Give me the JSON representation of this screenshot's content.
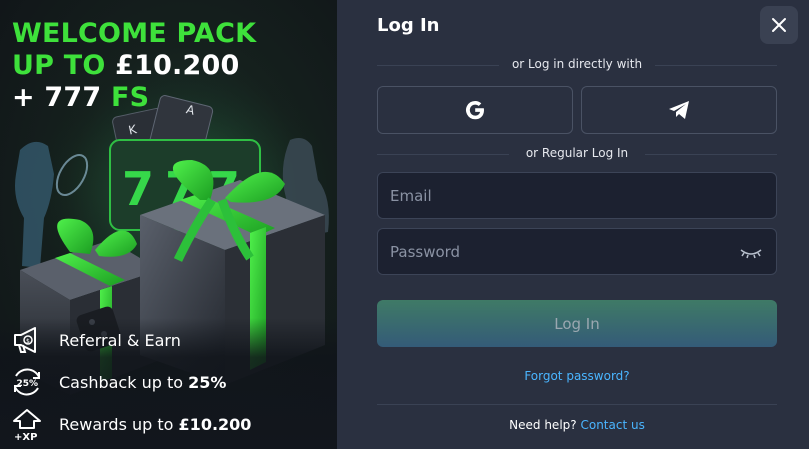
{
  "promo": {
    "headline_line1": "WELCOME PACK",
    "headline_line2_prefix": "UP TO ",
    "headline_line2_amount": "£10.200",
    "headline_line3_prefix": "+ 777 ",
    "headline_line3_suffix": "FS",
    "cashback_badge": "25%",
    "xp_badge": "+XP",
    "perks": [
      {
        "label": "Referral & Earn",
        "bold": "",
        "icon": "megaphone-dollar-icon"
      },
      {
        "label": "Cashback up to ",
        "bold": "25%",
        "icon": "cashback-25-icon"
      },
      {
        "label": "Rewards up to ",
        "bold": "£10.200",
        "icon": "xp-house-icon"
      }
    ],
    "accent_color": "#3ee13b"
  },
  "login": {
    "title": "Log In",
    "direct_label": "or Log in directly with",
    "regular_label": "or Regular Log In",
    "email_placeholder": "Email",
    "password_placeholder": "Password",
    "submit_label": "Log In",
    "forgot_label": "Forgot password?",
    "help_prefix": "Need help?",
    "help_link": "Contact us",
    "social": [
      {
        "name": "google",
        "icon": "google-icon"
      },
      {
        "name": "telegram",
        "icon": "telegram-icon"
      }
    ],
    "link_color": "#4ab5ff"
  }
}
